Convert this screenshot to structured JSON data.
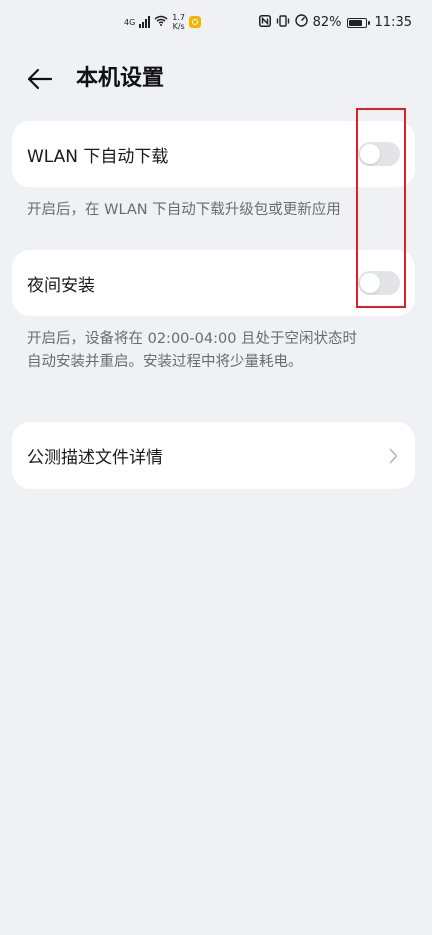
{
  "status_bar": {
    "network": "4G",
    "speed_value": "1.7",
    "speed_unit": "K/s",
    "battery": "82%",
    "time": "11:35"
  },
  "header": {
    "title": "本机设置"
  },
  "settings": {
    "wlan_download": {
      "label": "WLAN 下自动下载",
      "enabled": false,
      "description": "开启后，在 WLAN 下自动下载升级包或更新应用"
    },
    "night_install": {
      "label": "夜间安装",
      "enabled": false,
      "description_line1": "开启后，设备将在 02:00-04:00 且处于空闲状态时",
      "description_line2": "自动安装并重启。安装过程中将少量耗电。"
    },
    "beta_details": {
      "label": "公测描述文件详情"
    }
  },
  "colors": {
    "background": "#f0f1f5",
    "card": "#ffffff",
    "toggle_off": "#e3e4e8",
    "highlight": "#d8232a"
  }
}
